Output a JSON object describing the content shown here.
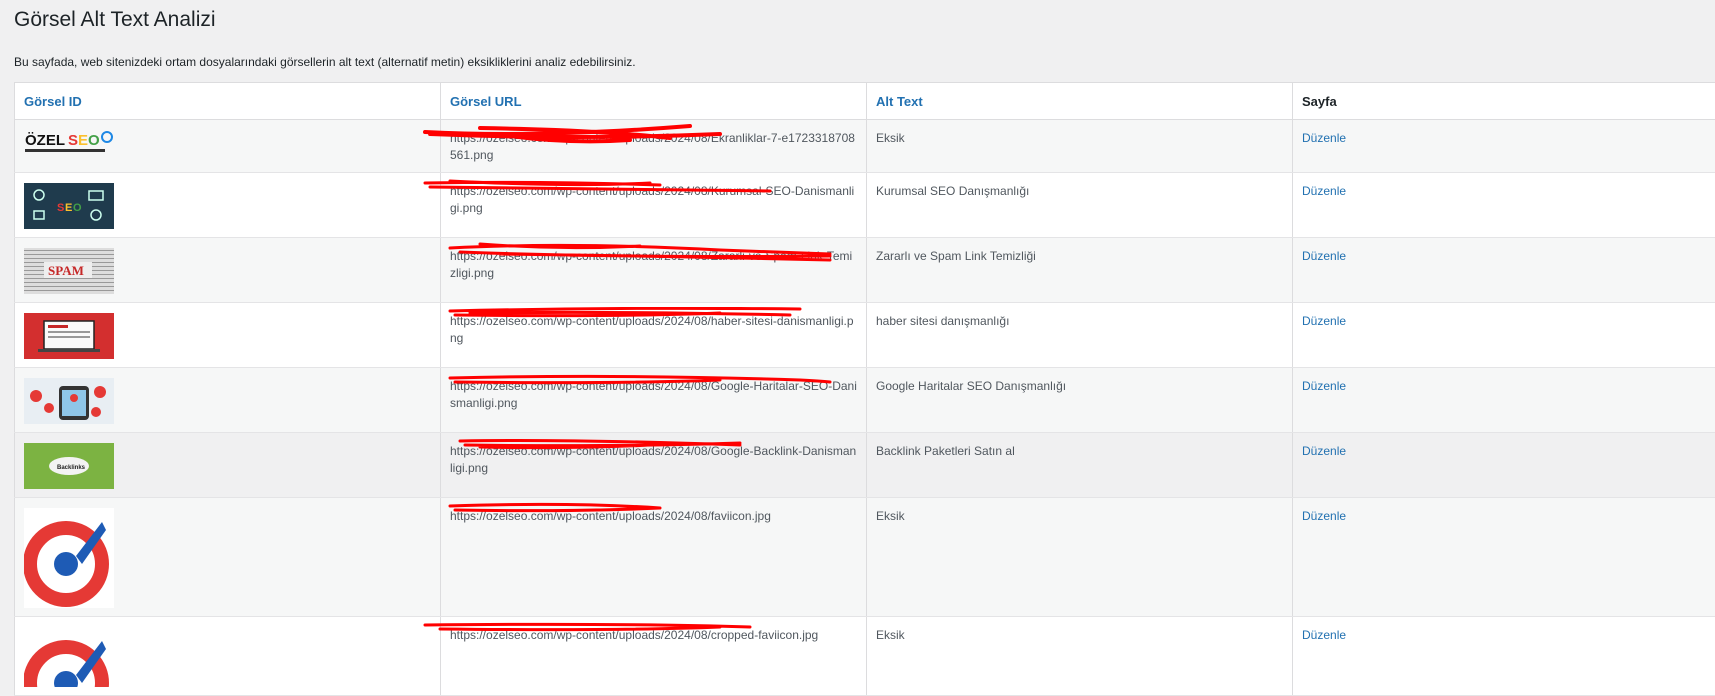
{
  "page": {
    "title": "Görsel Alt Text Analizi",
    "description": "Bu sayfada, web sitenizdeki ortam dosyalarındaki görsellerin alt text (alternatif metin) eksikliklerini analiz edebilirsiniz."
  },
  "table": {
    "headers": {
      "id": "Görsel ID",
      "url": "Görsel URL",
      "alt": "Alt Text",
      "page": "Sayfa"
    },
    "rows": [
      {
        "image": "ozelseo-logo",
        "url": "https://ozelseo.com/wp-content/uploads/2024/08/Ekranliklar-7-e1723318708561.png",
        "alt": "Eksik",
        "action": "Düzenle"
      },
      {
        "image": "seo-chalkboard",
        "url": "https://ozelseo.com/wp-content/uploads/2024/08/Kurumsal-SEO-Danismanligi.png",
        "alt": "Kurumsal SEO Danışmanlığı",
        "action": "Düzenle"
      },
      {
        "image": "spam-newspaper",
        "url": "https://ozelseo.com/wp-content/uploads/2024/08/Zararli-ve-Spam-Link-Temizligi.png",
        "alt": "Zararlı ve Spam Link Temizliği",
        "action": "Düzenle"
      },
      {
        "image": "laptop-red",
        "url": "https://ozelseo.com/wp-content/uploads/2024/08/haber-sitesi-danismanligi.png",
        "alt": "haber sitesi danışmanlığı",
        "action": "Düzenle"
      },
      {
        "image": "map-pins",
        "url": "https://ozelseo.com/wp-content/uploads/2024/08/Google-Haritalar-SEO-Danismanligi.png",
        "alt": "Google Haritalar SEO Danışmanlığı",
        "action": "Düzenle"
      },
      {
        "image": "backlinks-green",
        "url": "https://ozelseo.com/wp-content/uploads/2024/08/Google-Backlink-Danismanligi.png",
        "alt": "Backlink Paketleri Satın al",
        "action": "Düzenle"
      },
      {
        "image": "rocket-favicon",
        "url": "https://ozelseo.com/wp-content/uploads/2024/08/faviicon.jpg",
        "alt": "Eksik",
        "action": "Düzenle"
      },
      {
        "image": "rocket-favicon",
        "url": "https://ozelseo.com/wp-content/uploads/2024/08/cropped-faviicon.jpg",
        "alt": "Eksik",
        "action": "Düzenle"
      }
    ]
  },
  "colors": {
    "link": "#2271b1",
    "redaction": "#ff0000"
  }
}
